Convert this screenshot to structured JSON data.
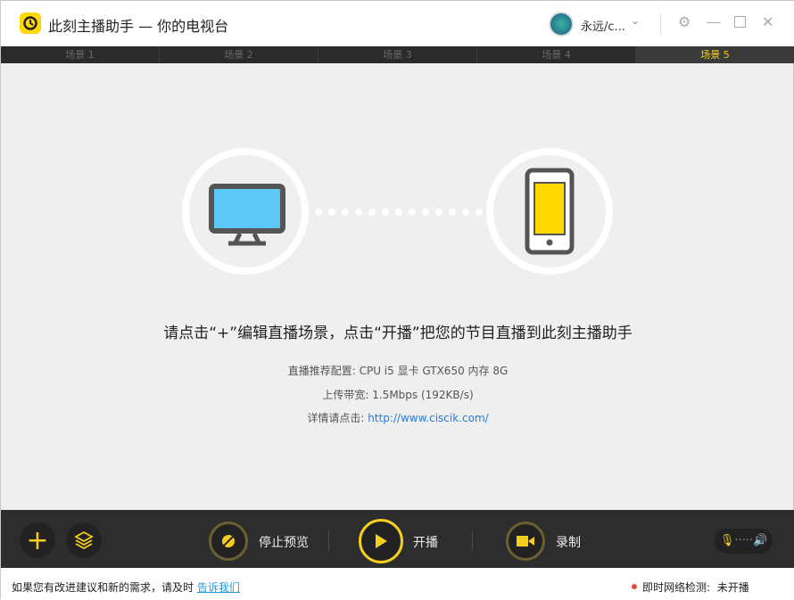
{
  "titlebar": {
    "title": "此刻主播助手 — 你的电视台",
    "user": "永远/c...",
    "icons": [
      "logo-icon",
      "avatar",
      "chevron-down-icon",
      "gear-icon",
      "minimize-icon",
      "maximize-icon",
      "close-icon"
    ]
  },
  "tabs": [
    {
      "label": "场景 1"
    },
    {
      "label": "场景 2"
    },
    {
      "label": "场景 3"
    },
    {
      "label": "场景 4"
    },
    {
      "label": "场景 5",
      "active": true
    }
  ],
  "main": {
    "headline": "请点击“+”编辑直播场景，点击“开播”把您的节目直播到此刻主播助手",
    "config_label": "直播推荐配置:",
    "config_value": "CPU  i5  显卡  GTX650  内存  8G",
    "bandwidth_label": "上传带宽:",
    "bandwidth_value": "1.5Mbps (192KB/s)",
    "details_label": "详情请点击:",
    "details_link": "http://www.ciscik.com/"
  },
  "bottombar": {
    "stop_preview": "停止预览",
    "start_live": "开播",
    "record": "录制"
  },
  "footer": {
    "feedback_text": "如果您有改进建议和新的需求，请及时",
    "feedback_link": "告诉我们",
    "network_label": "即时网络检测:",
    "network_status": "未开播",
    "status_color": "#e84c3d"
  },
  "colors": {
    "accent": "#f5cd1e",
    "screen": "#5bc8f5"
  }
}
